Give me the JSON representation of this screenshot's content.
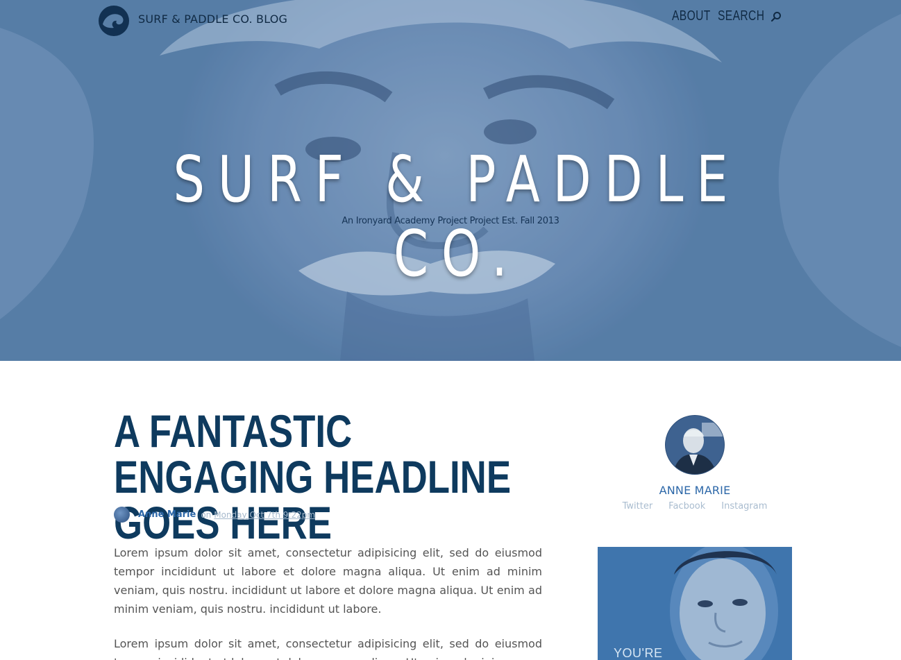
{
  "header": {
    "brand": "SURF & PADDLE CO. BLOG",
    "nav": {
      "about": "ABOUT",
      "search": "SEARCH"
    }
  },
  "hero": {
    "title": "SURF & PADDLE CO.",
    "subtitle": "An Ironyard Academy Project Project Est. Fall 2013"
  },
  "article": {
    "headline": "A FANTASTIC ENGAGING HEADLINE GOES HERE",
    "author": "Anne Marie",
    "on": "on",
    "date": "Monday Oct 7th 9:22pm",
    "paragraphs": [
      "Lorem ipsum dolor sit amet, consectetur adipisicing elit, sed do eiusmod tempor incididunt ut labore et dolore magna aliqua. Ut enim ad minim veniam, quis nostru. incididunt ut labore et dolore magna aliqua. Ut enim ad minim veniam, quis nostru. incididunt ut labore.",
      "Lorem ipsum dolor sit amet, consectetur adipisicing elit, sed do eiusmod tempor incididunt ut labore et dolore magna aliqua. Ut enim ad minim"
    ]
  },
  "sidebar": {
    "author_name": "ANNE MARIE",
    "links": {
      "twitter": "Twitter",
      "facebook": "Facbook",
      "instagram": "Instagram"
    },
    "promo_text": "YOU'RE"
  },
  "colors": {
    "hero_tint": "#5a80a8",
    "navy": "#0e3a5e",
    "link_blue": "#2c67a8",
    "muted": "#a9bccf"
  },
  "icons": [
    "wave-logo-icon",
    "search-icon"
  ]
}
